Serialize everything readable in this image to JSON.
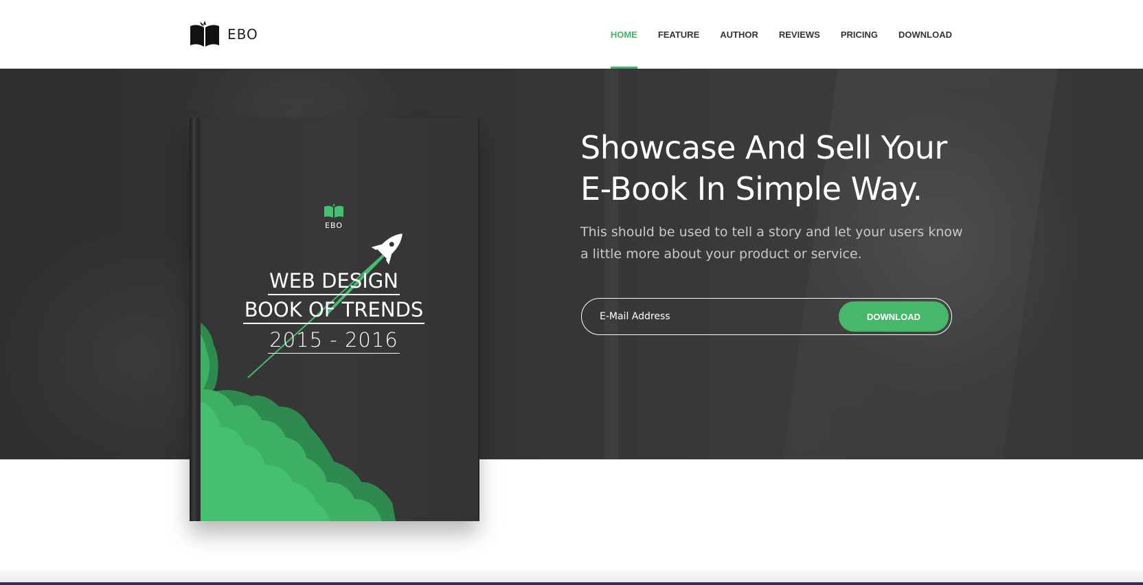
{
  "brand": {
    "name": "EBO",
    "icon": "open-book-icon"
  },
  "nav": {
    "items": [
      {
        "label": "HOME",
        "active": true
      },
      {
        "label": "FEATURE",
        "active": false
      },
      {
        "label": "AUTHOR",
        "active": false
      },
      {
        "label": "REVIEWS",
        "active": false
      },
      {
        "label": "PRICING",
        "active": false
      },
      {
        "label": "DOWNLOAD",
        "active": false
      }
    ]
  },
  "hero": {
    "title_line1": "Showcase And Sell Your",
    "title_line2": "E-Book In Simple Way.",
    "subtitle": "This should be used to tell a story and let your users know a little more about your product or service.",
    "email_placeholder": "E-Mail Address",
    "download_label": "DOWNLOAD"
  },
  "book": {
    "brand": "EBO",
    "title_line1": "WEB DESIGN",
    "title_line2": "BOOK OF TRENDS",
    "year": "2015 - 2016",
    "icon": "rocket-icon"
  },
  "colors": {
    "accent": "#47b769",
    "nav_text": "#333333",
    "hero_bg": "#404040"
  }
}
